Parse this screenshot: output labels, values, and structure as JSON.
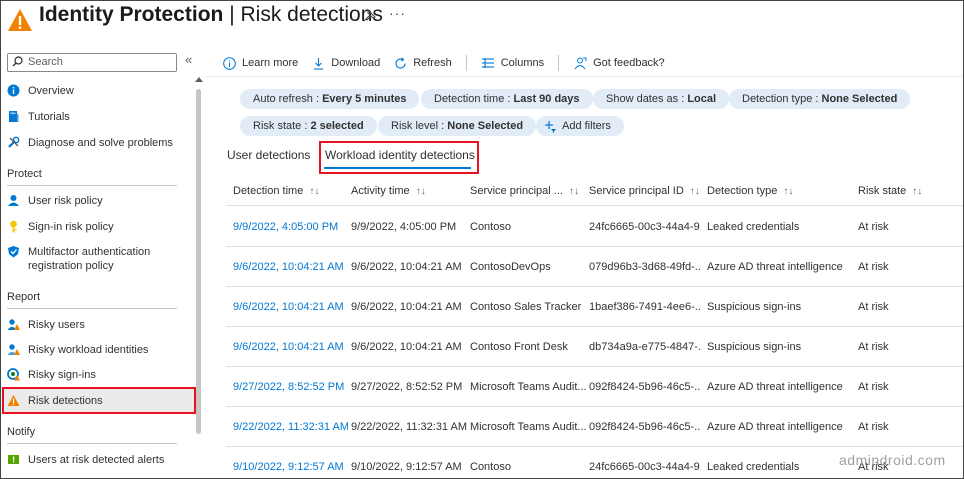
{
  "header": {
    "title_bold": "Identity Protection",
    "title_rest": " | Risk detections",
    "more": "···"
  },
  "sidebar": {
    "search_placeholder": "Search",
    "collapse": "«",
    "items_top": [
      {
        "label": "Overview",
        "icon": "info-icon"
      },
      {
        "label": "Tutorials",
        "icon": "book-icon"
      },
      {
        "label": "Diagnose and solve problems",
        "icon": "wrench-icon"
      }
    ],
    "section_protect": "Protect",
    "items_protect": [
      {
        "label": "User risk policy",
        "icon": "user-icon"
      },
      {
        "label": "Sign-in risk policy",
        "icon": "key-icon"
      },
      {
        "label_line1": "Multifactor authentication",
        "label_line2": "registration policy",
        "icon": "shield-icon"
      }
    ],
    "section_report": "Report",
    "items_report": [
      {
        "label": "Risky users",
        "icon": "risky-user-icon"
      },
      {
        "label": "Risky workload identities",
        "icon": "risky-workload-icon"
      },
      {
        "label": "Risky sign-ins",
        "icon": "risky-signin-icon"
      },
      {
        "label": "Risk detections",
        "icon": "warning-icon"
      }
    ],
    "section_notify": "Notify",
    "items_notify": [
      {
        "label": "Users at risk detected alerts",
        "icon": "alert-icon"
      }
    ]
  },
  "toolbar": {
    "learn_more": "Learn more",
    "download": "Download",
    "refresh": "Refresh",
    "columns": "Columns",
    "feedback": "Got feedback?"
  },
  "filters": {
    "auto_refresh_label": "Auto refresh : ",
    "auto_refresh_value": "Every 5 minutes",
    "detection_time_label": "Detection time : ",
    "detection_time_value": "Last 90 days",
    "show_dates_label": "Show dates as : ",
    "show_dates_value": "Local",
    "detection_type_label": "Detection type : ",
    "detection_type_value": "None Selected",
    "risk_state_label": "Risk state : ",
    "risk_state_value": "2 selected",
    "risk_level_label": "Risk level : ",
    "risk_level_value": "None Selected",
    "add_filters": "Add filters"
  },
  "tabs": {
    "user": "User detections",
    "workload": "Workload identity detections"
  },
  "table": {
    "columns": [
      "Detection time",
      "Activity time",
      "Service principal ...",
      "Service principal ID",
      "Detection type",
      "Risk state"
    ],
    "sort_glyph_first": "↑↓",
    "sort_glyph": "↑↓",
    "rows": [
      [
        "9/9/2022, 4:05:00 PM",
        "9/9/2022, 4:05:00 PM",
        "Contoso",
        "24fc6665-00c3-44a4-9...",
        "Leaked credentials",
        "At risk"
      ],
      [
        "9/6/2022, 10:04:21 AM",
        "9/6/2022, 10:04:21 AM",
        "ContosoDevOps",
        "079d96b3-3d68-49fd-...",
        "Azure AD threat intelligence",
        "At risk"
      ],
      [
        "9/6/2022, 10:04:21 AM",
        "9/6/2022, 10:04:21 AM",
        "Contoso Sales Tracker",
        "1baef386-7491-4ee6-...",
        "Suspicious sign-ins",
        "At risk"
      ],
      [
        "9/6/2022, 10:04:21 AM",
        "9/6/2022, 10:04:21 AM",
        "Contoso Front Desk",
        "db734a9a-e775-4847-...",
        "Suspicious sign-ins",
        "At risk"
      ],
      [
        "9/27/2022, 8:52:52 PM",
        "9/27/2022, 8:52:52 PM",
        "Microsoft Teams Audit...",
        "092f8424-5b96-46c5-...",
        "Azure AD threat intelligence",
        "At risk"
      ],
      [
        "9/22/2022, 11:32:31 AM",
        "9/22/2022, 11:32:31 AM",
        "Microsoft Teams Audit...",
        "092f8424-5b96-46c5-...",
        "Azure AD threat intelligence",
        "At risk"
      ],
      [
        "9/10/2022, 9:12:57 AM",
        "9/10/2022, 9:12:57 AM",
        "Contoso",
        "24fc6665-00c3-44a4-9...",
        "Leaked credentials",
        "At risk"
      ]
    ]
  },
  "watermark": "admindroid.com",
  "colors": {
    "accent": "#0078d4",
    "highlight": "#e81123",
    "pill": "#e1ecf7",
    "warning": "#f7a400"
  }
}
